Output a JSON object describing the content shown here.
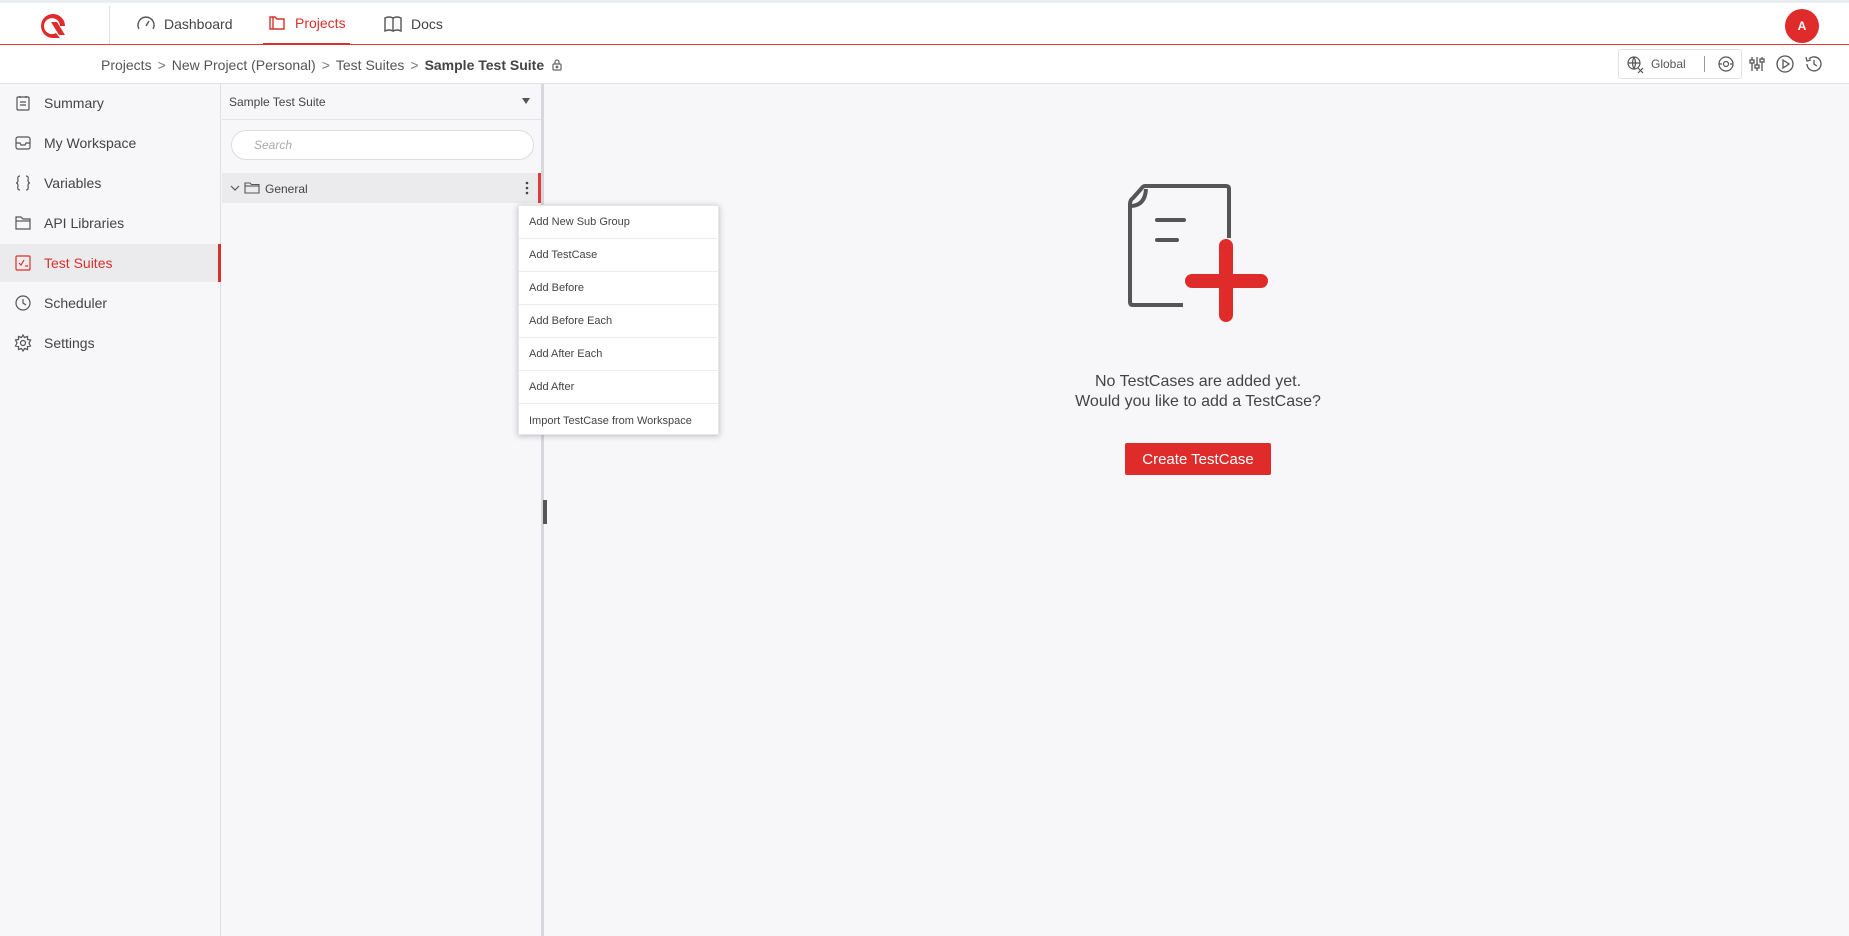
{
  "nav": {
    "items": [
      {
        "label": "Dashboard",
        "icon": "speedometer-icon"
      },
      {
        "label": "Projects",
        "icon": "folder-icon",
        "active": true
      },
      {
        "label": "Docs",
        "icon": "book-icon"
      }
    ],
    "avatar_initial": "A",
    "brand_color": "#e02b2b"
  },
  "breadcrumb": {
    "items": [
      "Projects",
      "New Project (Personal)",
      "Test Suites"
    ],
    "current": "Sample Test Suite",
    "separator": ">"
  },
  "toolbar": {
    "environment": "Global"
  },
  "sidebar": {
    "items": [
      {
        "label": "Summary",
        "icon": "clipboard-icon"
      },
      {
        "label": "My Workspace",
        "icon": "inbox-icon"
      },
      {
        "label": "Variables",
        "icon": "braces-icon"
      },
      {
        "label": "API Libraries",
        "icon": "folder-icon"
      },
      {
        "label": "Test Suites",
        "icon": "checklist-icon",
        "active": true
      },
      {
        "label": "Scheduler",
        "icon": "clock-icon"
      },
      {
        "label": "Settings",
        "icon": "gear-icon"
      }
    ]
  },
  "tree": {
    "suite_selected": "Sample Test Suite",
    "search_placeholder": "Search",
    "group_label": "General"
  },
  "context_menu": {
    "items": [
      "Add New Sub Group",
      "Add TestCase",
      "Add Before",
      "Add Before Each",
      "Add After Each",
      "Add After",
      "Import TestCase from Workspace"
    ]
  },
  "empty_state": {
    "line1": "No TestCases are added yet.",
    "line2": "Would you like to add a TestCase?",
    "button": "Create TestCase"
  }
}
